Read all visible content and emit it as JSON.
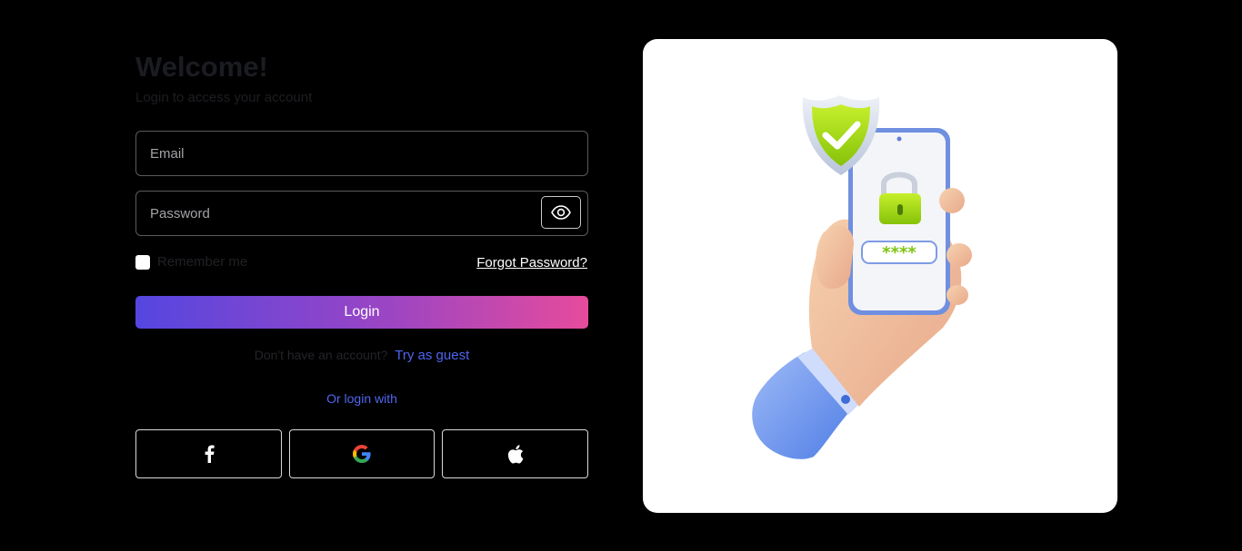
{
  "header": {
    "title": "Welcome!",
    "subtitle": "Login to access your account"
  },
  "form": {
    "email_placeholder": "Email",
    "password_placeholder": "Password",
    "remember_label": "Remember me",
    "forgot_label": "Forgot Password?",
    "login_label": "Login"
  },
  "signup": {
    "prompt": "Don't have an account?",
    "guest_label": "Try as guest"
  },
  "social": {
    "divider_label": "Or login with",
    "providers": [
      "facebook-icon",
      "google-icon",
      "apple-icon"
    ]
  },
  "illustration": {
    "pin_mask": "****",
    "accent_green": "#9bd40b",
    "accent_blue": "#5b86e8"
  }
}
